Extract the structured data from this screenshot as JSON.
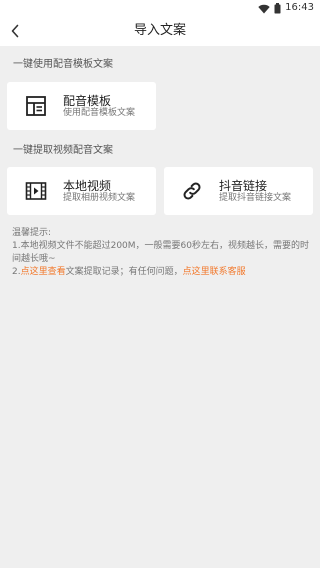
{
  "status_bar": {
    "time": "16:43",
    "icons": [
      "wifi-icon",
      "battery-icon"
    ]
  },
  "header": {
    "title": "导入文案",
    "back_icon": "chevron-left-icon"
  },
  "sections": {
    "dubbing_template": {
      "label": "一键使用配音模板文案",
      "card": {
        "icon": "template-layout-icon",
        "title": "配音模板",
        "subtitle": "使用配音模板文案"
      }
    },
    "video_extract": {
      "label": "一键提取视频配音文案",
      "cards": [
        {
          "icon": "film-icon",
          "title": "本地视频",
          "subtitle": "提取相册视频文案"
        },
        {
          "icon": "link-icon",
          "title": "抖音链接",
          "subtitle": "提取抖音链接文案"
        }
      ]
    }
  },
  "tips": {
    "heading": "温馨提示:",
    "line1": "1.本地视频文件不能超过200M，一般需要60秒左右，视频越长，需要的时间越长哦~",
    "line2_prefix": "2.",
    "line2_link1": "点这里查看",
    "line2_middle": "文案提取记录；有任何问题，",
    "line2_link2": "点这里联系客服"
  },
  "colors": {
    "background": "#efefef",
    "card": "#ffffff",
    "accent": "#f2782b"
  }
}
